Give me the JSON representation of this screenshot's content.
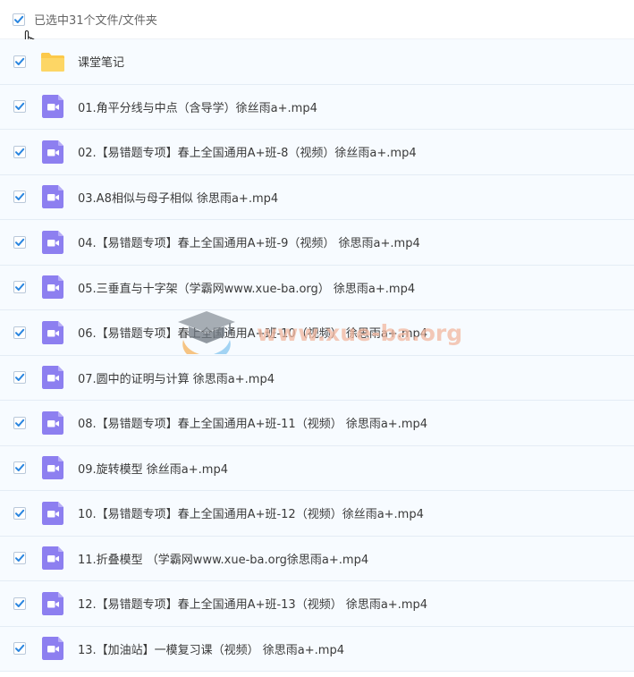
{
  "header": {
    "selection_text": "已选中31个文件/文件夹"
  },
  "colors": {
    "check": "#2a86e0",
    "folder": "#fcc94a",
    "video": "#8d7ff0",
    "row_bg": "#f7fbff",
    "watermark": "#f2b8a0"
  },
  "files": [
    {
      "name": "课堂笔记",
      "type": "folder",
      "icon": "folder-icon"
    },
    {
      "name": "01.角平分线与中点（含导学）徐丝雨a+.mp4",
      "type": "video",
      "icon": "video-file-icon"
    },
    {
      "name": "02.【易错题专项】春上全国通用A+班-8（视频）徐丝雨a+.mp4",
      "type": "video",
      "icon": "video-file-icon"
    },
    {
      "name": "03.A8相似与母子相似 徐思雨a+.mp4",
      "type": "video",
      "icon": "video-file-icon"
    },
    {
      "name": "04.【易错题专项】春上全国通用A+班-9（视频） 徐思雨a+.mp4",
      "type": "video",
      "icon": "video-file-icon"
    },
    {
      "name": "05.三垂直与十字架（学霸网www.xue-ba.org） 徐思雨a+.mp4",
      "type": "video",
      "icon": "video-file-icon"
    },
    {
      "name": "06.【易错题专项】春上全国通用A+班-10（视频） 徐思雨a+.mp4",
      "type": "video",
      "icon": "video-file-icon"
    },
    {
      "name": "07.圆中的证明与计算 徐思雨a+.mp4",
      "type": "video",
      "icon": "video-file-icon"
    },
    {
      "name": "08.【易错题专项】春上全国通用A+班-11（视频） 徐思雨a+.mp4",
      "type": "video",
      "icon": "video-file-icon"
    },
    {
      "name": "09.旋转模型 徐丝雨a+.mp4",
      "type": "video",
      "icon": "video-file-icon"
    },
    {
      "name": "10.【易错题专项】春上全国通用A+班-12（视频）徐丝雨a+.mp4",
      "type": "video",
      "icon": "video-file-icon"
    },
    {
      "name": "11.折叠模型 （学霸网www.xue-ba.org徐思雨a+.mp4",
      "type": "video",
      "icon": "video-file-icon"
    },
    {
      "name": "12.【易错题专项】春上全国通用A+班-13（视频） 徐思雨a+.mp4",
      "type": "video",
      "icon": "video-file-icon"
    },
    {
      "name": "13.【加油站】一模复习课（视频） 徐思雨a+.mp4",
      "type": "video",
      "icon": "video-file-icon"
    }
  ],
  "watermark": {
    "text": "www.xue-ba.org",
    "icon": "graduation-cap-icon"
  }
}
